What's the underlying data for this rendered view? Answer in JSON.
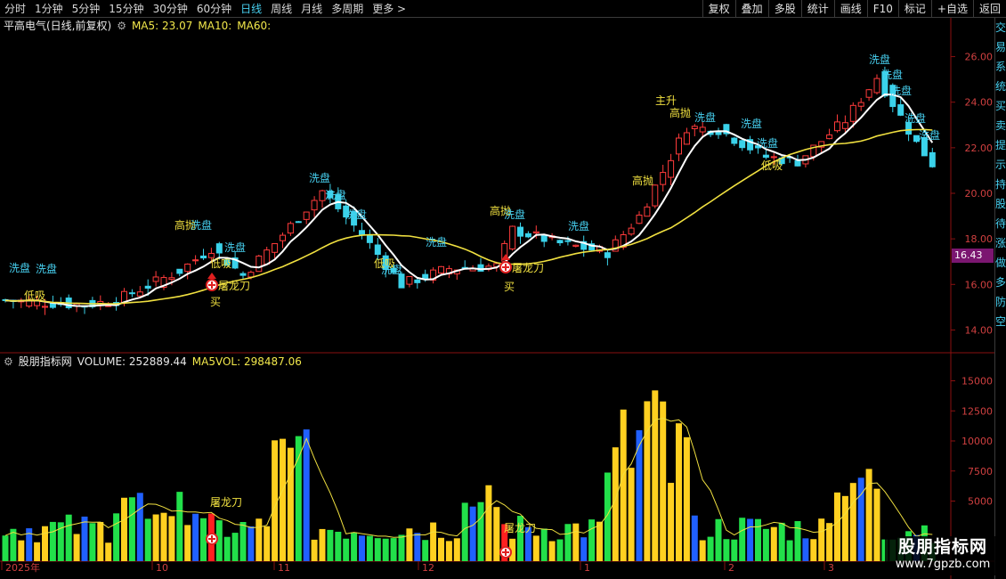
{
  "toolbar": {
    "periods": [
      "分时",
      "1分钟",
      "5分钟",
      "15分钟",
      "30分钟",
      "60分钟",
      "日线",
      "周线",
      "月线",
      "多周期",
      "更多 >"
    ],
    "active_period": "日线",
    "buttons": [
      "复权",
      "叠加",
      "多股",
      "统计",
      "画线",
      "F10",
      "标记",
      "+自选",
      "返回"
    ]
  },
  "price_panel": {
    "stock": "平高电气(日线,前复权)",
    "ma5": "MA5: 23.07",
    "ma10": "MA10:",
    "ma60": "MA60:",
    "y_ticks": [
      "26.00",
      "24.00",
      "22.00",
      "20.00",
      "18.00",
      "16.00",
      "14.00"
    ],
    "current_price": "16.43",
    "signals": [
      "洗盘",
      "低吸",
      "高抛",
      "主升",
      "屠龙刀",
      "买"
    ]
  },
  "volume_panel": {
    "title": "股朋指标网",
    "volume": "VOLUME: 252889.44",
    "ma5vol": "MA5VOL: 298487.06",
    "y_ticks": [
      "15000",
      "12500",
      "10000",
      "7500",
      "5000"
    ],
    "signal": "屠龙刀"
  },
  "x_axis": [
    "2025年",
    "10",
    "11",
    "12",
    "1",
    "2",
    "3"
  ],
  "right_sidebar": [
    "交",
    "易",
    "系",
    "统",
    "买",
    "卖",
    "提",
    "示",
    "持",
    "股",
    "待",
    "涨",
    "做",
    "多",
    "防",
    "空"
  ],
  "watermark": {
    "line1": "股朋指标网",
    "line2": "www.7gpzb.com"
  },
  "colors": {
    "up": "#ff3b3b",
    "down": "#3ad2ea",
    "ma_white": "#ffffff",
    "ma_yellow": "#f0e040",
    "vol_yellow": "#ffd020",
    "vol_green": "#22e04a",
    "vol_blue": "#2060ff",
    "vol_red": "#ff2020"
  },
  "chart_data": {
    "type": "candlestick",
    "x": [
      "2025年",
      "10",
      "11",
      "12",
      "1",
      "2",
      "3"
    ],
    "ylim_price": [
      13.0,
      27.0
    ],
    "ylim_volume": [
      0,
      16000
    ]
  }
}
